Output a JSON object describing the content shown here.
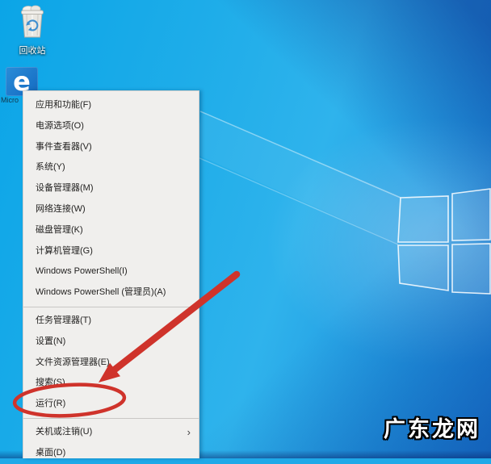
{
  "desktop": {
    "icons": [
      {
        "id": "recycle-bin",
        "label": "回收站"
      },
      {
        "id": "edge",
        "glyph": "e",
        "label_fragment": "Micro"
      }
    ],
    "watermark": {
      "text": "广东龙网"
    }
  },
  "context_menu": {
    "items": [
      {
        "label": "应用和功能(F)"
      },
      {
        "label": "电源选项(O)"
      },
      {
        "label": "事件查看器(V)"
      },
      {
        "label": "系统(Y)"
      },
      {
        "label": "设备管理器(M)"
      },
      {
        "label": "网络连接(W)"
      },
      {
        "label": "磁盘管理(K)"
      },
      {
        "label": "计算机管理(G)"
      },
      {
        "label": "Windows PowerShell(I)"
      },
      {
        "label": "Windows PowerShell (管理员)(A)"
      },
      {
        "label": "任务管理器(T)"
      },
      {
        "label": "设置(N)"
      },
      {
        "label": "文件资源管理器(E)"
      },
      {
        "label": "搜索(S)"
      },
      {
        "label": "运行(R)",
        "highlighted": true
      },
      {
        "label": "关机或注销(U)",
        "has_submenu": true
      },
      {
        "label": "桌面(D)"
      }
    ],
    "submenu_chevron": "›"
  },
  "annotations": {
    "target_item": "运行(R)",
    "shapes": [
      "red-ellipse-around-run",
      "red-arrow-pointing-to-run"
    ],
    "color": "#cf332b"
  },
  "colors": {
    "annotation_red": "#cf332b",
    "menu_background": "#f0efed",
    "menu_text": "#201f1e",
    "wallpaper_azure": "#1fa9e8",
    "watermark_text": "#ffffff"
  }
}
